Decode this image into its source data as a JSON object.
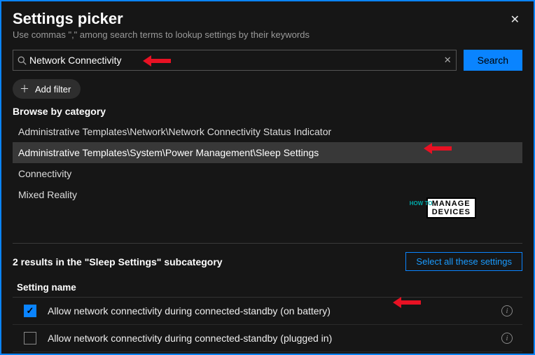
{
  "header": {
    "title": "Settings picker",
    "subtitle": "Use commas \",\" among search terms to lookup settings by their keywords",
    "close": "✕"
  },
  "search": {
    "value": "Network Connectivity",
    "placeholder": "",
    "button": "Search"
  },
  "filter": {
    "add": "Add filter"
  },
  "browse": {
    "label": "Browse by category",
    "items": [
      "Administrative Templates\\Network\\Network Connectivity Status Indicator",
      "Administrative Templates\\System\\Power Management\\Sleep Settings",
      "Connectivity",
      "Mixed Reality"
    ]
  },
  "results": {
    "summary": "2 results in the \"Sleep Settings\" subcategory",
    "select_all": "Select all these settings",
    "column": "Setting name",
    "rows": [
      {
        "checked": true,
        "label": "Allow network connectivity during connected-standby (on battery)"
      },
      {
        "checked": false,
        "label": "Allow network connectivity during connected-standby (plugged in)"
      }
    ]
  },
  "watermark": {
    "l1": "MANAGE",
    "l2": "DEVICES",
    "side": "HOW TO"
  }
}
